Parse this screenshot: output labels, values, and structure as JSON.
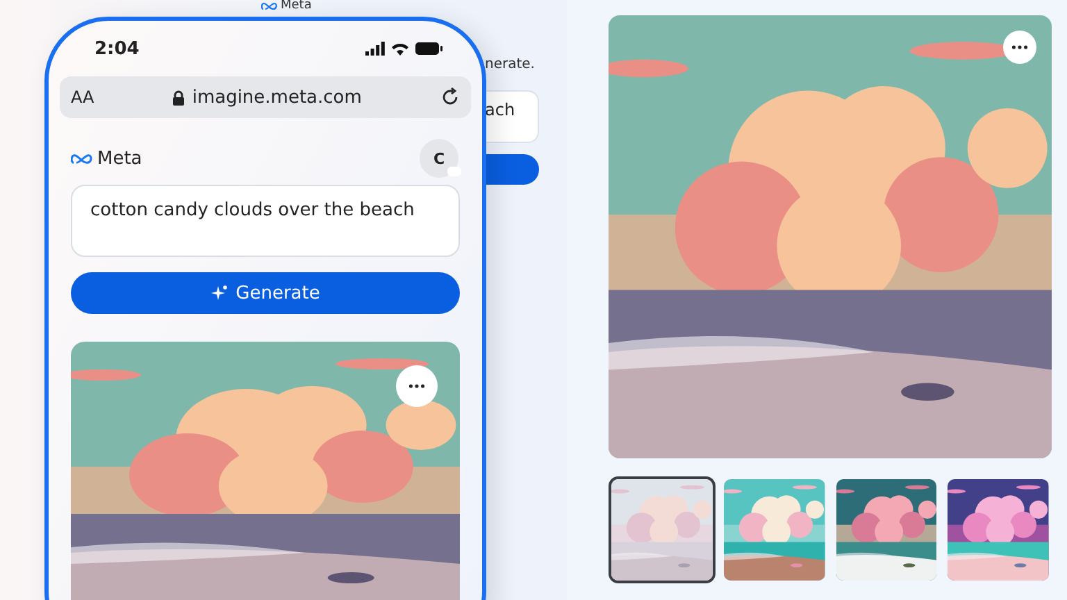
{
  "desktop": {
    "logo": "Meta",
    "hint_fragment": "nerate.",
    "prompt_fragment": "ach"
  },
  "phone": {
    "time": "2:04",
    "text_size_button": "AA",
    "url": "imagine.meta.com",
    "brand": "Meta",
    "avatar_initial": "C",
    "prompt": "cotton candy clouds over the beach",
    "generate_label": "Generate"
  },
  "preview": {
    "thumbnails": [
      {
        "selected": true
      },
      {
        "selected": false
      },
      {
        "selected": false
      },
      {
        "selected": false
      }
    ]
  }
}
